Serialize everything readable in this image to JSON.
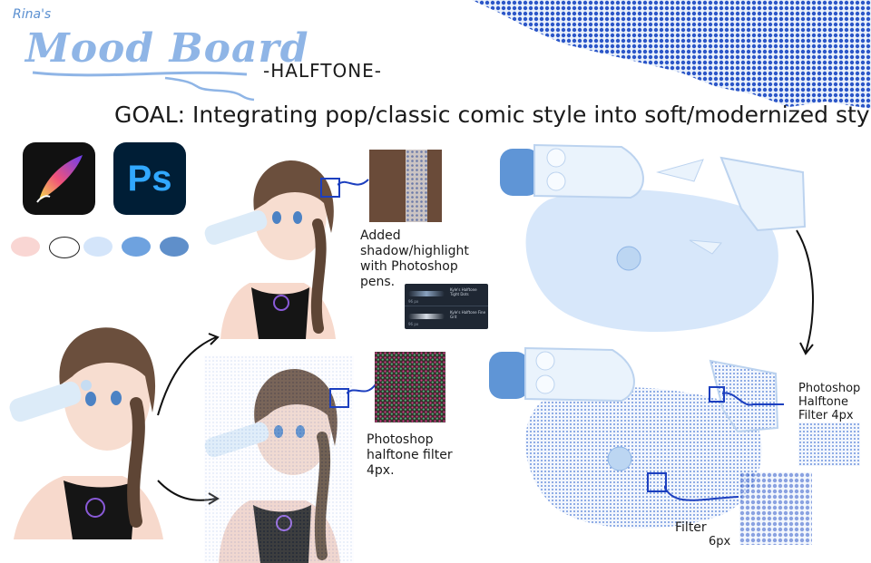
{
  "header": {
    "author": "Rina's",
    "title": "Mood Board",
    "subtitle": "-HALFTONE-",
    "goal": "GOAL: Integrating pop/classic comic style into soft/modernized style"
  },
  "apps": {
    "photoshop_label": "Ps"
  },
  "icons": [
    "procreate-icon",
    "photoshop-icon",
    "arrow-icon",
    "zoom-box-icon"
  ],
  "palette": [
    "#f9d6d3",
    "#ffffff",
    "#d4e5fa",
    "#6ea2df",
    "#5f8fca"
  ],
  "captions": {
    "shadow": "Added\nshadow/highlight\nwith Photoshop\npens.",
    "halftone_filter": "Photoshop\nhalftone filter\n4px.",
    "right_top": "Photoshop\nHalftone\nFilter 4px",
    "right_bottom_line1": "Filter",
    "right_bottom_line2": "6px"
  },
  "brush_panel": {
    "brush_a": "Kyle's Halftone Tight Dots",
    "brush_b": "Kyle's Halftone Fine Grit",
    "size_a": "96 px",
    "size_b": "96 px"
  },
  "colors": {
    "accent_blue": "#1c3fbf",
    "title_blue": "#8fb5e6",
    "halftone_blue": "#2b56c8"
  }
}
